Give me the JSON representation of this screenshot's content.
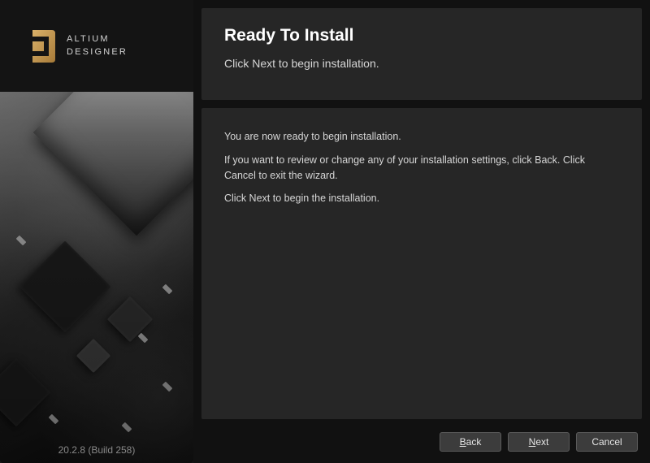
{
  "brand": {
    "line1": "ALTIUM",
    "line2": "DESIGNER"
  },
  "version": "20.2.8 (Build 258)",
  "header": {
    "title": "Ready To Install",
    "subtitle": "Click Next to begin installation."
  },
  "content": {
    "p1": "You are now ready to begin installation.",
    "p2": "If you want to review or change any of your installation settings, click Back. Click Cancel to exit the wizard.",
    "p3": "Click Next to begin the installation."
  },
  "buttons": {
    "back": "Back",
    "next": "Next",
    "cancel": "Cancel"
  }
}
